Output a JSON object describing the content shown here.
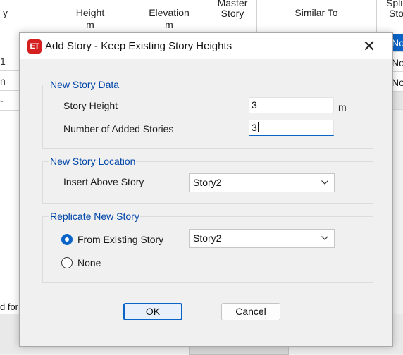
{
  "background_grid": {
    "columns": [
      {
        "title": "y",
        "unit": ""
      },
      {
        "title": "Height",
        "unit": "m"
      },
      {
        "title": "Elevation",
        "unit": "m"
      },
      {
        "title": "Master",
        "subtitle": "Story"
      },
      {
        "title": "Similar To",
        "unit": ""
      },
      {
        "title": "Splic",
        "unit": "Sto"
      }
    ],
    "left_rows": [
      "",
      "1",
      "n",
      "-"
    ],
    "right_cells": [
      "No",
      "No",
      "No"
    ],
    "bottom_left_text": "d for"
  },
  "dialog": {
    "icon_text": "ET",
    "title": "Add Story - Keep Existing Story Heights",
    "close_glyph": "✕",
    "new_story_data": {
      "group_title": "New Story Data",
      "story_height_label": "Story Height",
      "story_height_value": "3",
      "story_height_unit": "m",
      "num_stories_label": "Number of Added Stories",
      "num_stories_value": "3"
    },
    "new_story_location": {
      "group_title": "New Story Location",
      "insert_above_label": "Insert Above Story",
      "insert_above_value": "Story2"
    },
    "replicate_new_story": {
      "group_title": "Replicate New Story",
      "from_existing_label": "From Existing Story",
      "from_existing_selected": true,
      "from_existing_value": "Story2",
      "none_label": "None",
      "none_selected": false
    },
    "ok_label": "OK",
    "cancel_label": "Cancel"
  },
  "colors": {
    "accent": "#0a64c8",
    "group_title": "#0046a8",
    "icon_red": "#d42020"
  }
}
